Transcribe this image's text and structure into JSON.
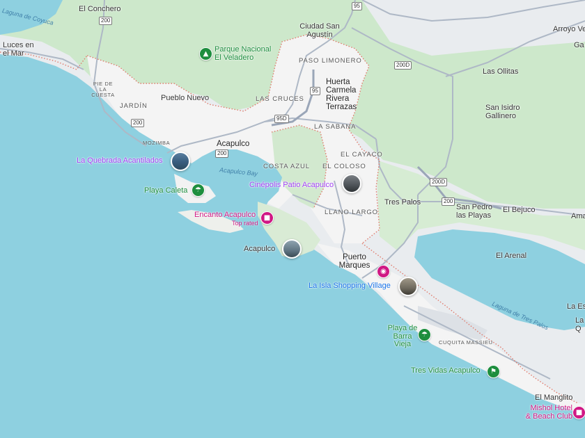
{
  "colors": {
    "ocean": "#8ed0e0",
    "land": "#e9ecef",
    "forest": "#cde8cb",
    "urban": "#f5f5f5",
    "boundary": "#e07a6b",
    "road": "#aeb8c6",
    "highway": "#9aa6b8",
    "airport": "#d9dde3"
  },
  "places": {
    "el_concheiro": "El Conchero",
    "ciudad_san_agustin": "Ciudad San Agustín",
    "arroyo_verde": "Arroyo Ve",
    "ga": "Ga",
    "luces_en_el_mar": "Luces en el Mar",
    "paso_limonero": "PASO LIMONERO",
    "huerta_carmela": "Huerta Carmela Rivera Terrazas",
    "las_ollitas": "Las Ollitas",
    "pie_de_la_cuesta": "PIE DE LA CUESTA",
    "jardin": "JARDÍN",
    "pueblo_nuevo": "Pueblo Nuevo",
    "las_cruces": "LAS CRUCES",
    "san_isidro": "San Isidro Gallinero",
    "la_sabana": "LA SABANA",
    "mozimba": "MOZIMBA",
    "acapulco_city": "Acapulco",
    "el_cayaco": "EL CAYACO",
    "el_coloso": "EL COLOSO",
    "costa_azul": "COSTA AZUL",
    "tres_palos": "Tres Palos",
    "san_pedro": "San Pedro las Playas",
    "el_bejuco": "El Bejuco",
    "ama": "Ama",
    "llano_largo": "LLANO LARGO",
    "el_arenal": "El Arenal",
    "puerto_marques": "Puerto Marques",
    "cuquita_massieu": "CUQUITA MASSIEU",
    "el_manglito": "El Manglito",
    "la_es": "La Es",
    "la_q": "La Q",
    "acapulco_lower": "Acapulco"
  },
  "water": {
    "laguna_coyuca": "Laguna de Coyuca",
    "acapulco_bay": "Acapulco Bay",
    "laguna_tres_palos": "Laguna de Tres Palos"
  },
  "pois": {
    "parque_veladero": "Parque Nacional El Veladero",
    "la_quebrada": "La Quebrada Acantilados",
    "playa_caleta": "Playa Caleta",
    "cinepolis": "Cinépolis Patio Acapulco",
    "encanto": "Encanto Acapulco",
    "encanto_sub": "Top rated",
    "isla_shopping": "La Isla Shopping Village",
    "barra_vieja": "Playa de Barra Vieja",
    "tres_vidas": "Tres Vidas Acapulco",
    "mishol": "Mishol Hotel & Beach Club"
  },
  "shields": {
    "r95_top": "95",
    "r200_north": "200",
    "r200d_a": "200D",
    "r95_mid": "95",
    "r200_west": "200",
    "r950": "95D",
    "r200_city": "200",
    "r200d_b": "200D",
    "r200_east": "200"
  },
  "icons": {
    "tree": "tree-icon",
    "beach": "beach-umbrella-icon",
    "hotel": "hotel-bed-icon",
    "shopping": "shopping-bag-icon",
    "golf": "golf-icon"
  }
}
